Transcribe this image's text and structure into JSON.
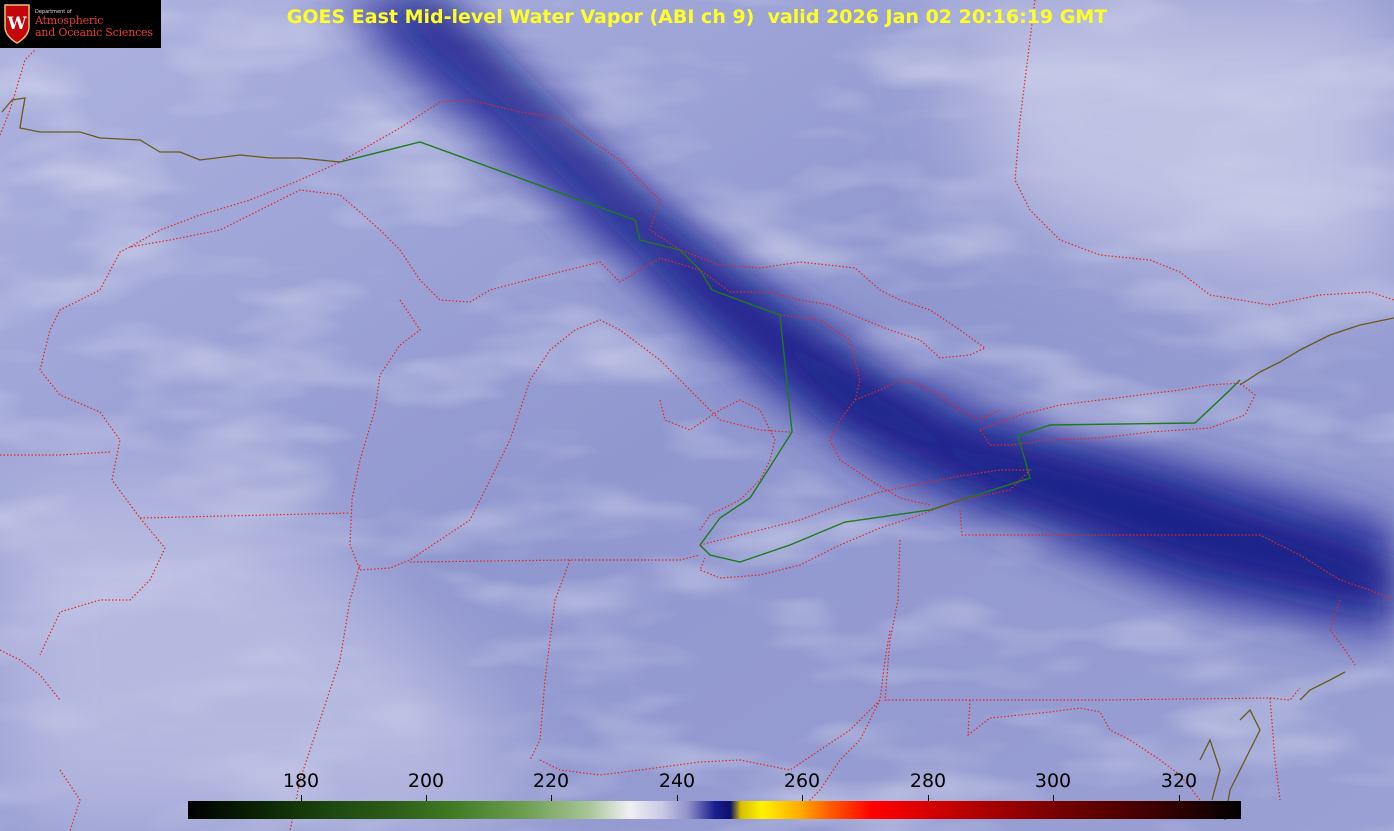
{
  "header": {
    "title": "GOES East Mid-level Water Vapor (ABI ch 9)  valid 2026 Jan 02 20:16:19 GMT"
  },
  "logo": {
    "department": "Department of",
    "line1": "Atmospheric",
    "line2": "and Oceanic Sciences",
    "seal_letter": "W"
  },
  "colorbar": {
    "labels": [
      "180",
      "200",
      "220",
      "240",
      "260",
      "280",
      "300",
      "320"
    ],
    "range_min": 168,
    "range_max": 335
  },
  "colors": {
    "title": "#ffff28",
    "state_borders": "#e32727",
    "international_border": "#1d7a1d",
    "coastline": "#6a5a1a"
  },
  "map": {
    "product": "water-vapor-satellite-imagery"
  }
}
